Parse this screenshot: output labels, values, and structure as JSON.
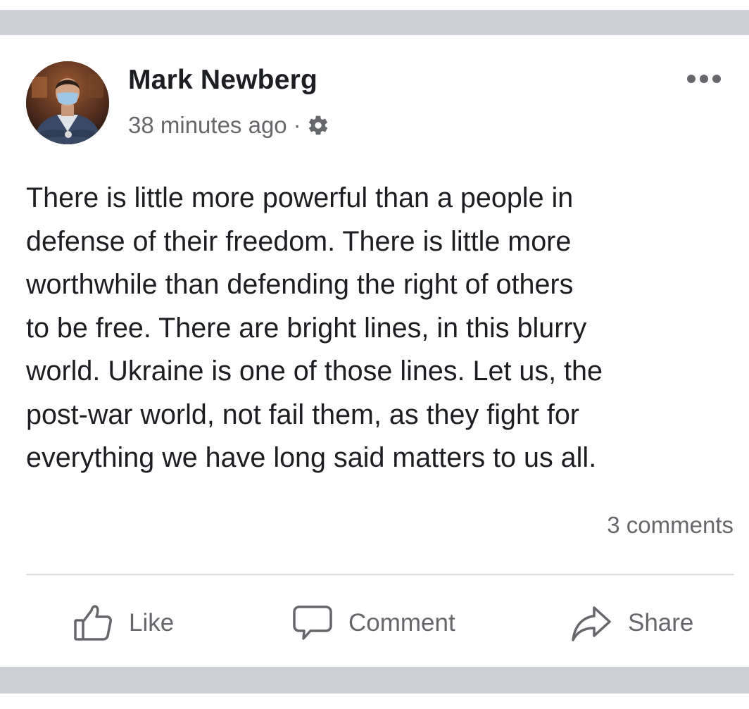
{
  "post": {
    "author": "Mark Newberg",
    "timestamp": "38 minutes ago",
    "separator": "·",
    "privacy_icon": "gear-icon",
    "more_icon": "more-options-icon",
    "text": "There is little more powerful than a people in\ndefense of their freedom. There is little more\nworthwhile than defending the right of others\nto be free. There are bright lines, in this blurry\nworld. Ukraine is one of those lines. Let us, the\npost-war world, not fail them, as they fight for\neverything we have long said matters to us all.",
    "comments_count": "3 comments"
  },
  "actions": {
    "like": {
      "label": "Like",
      "icon": "thumbs-up-icon"
    },
    "comment": {
      "label": "Comment",
      "icon": "comment-bubble-icon"
    },
    "share": {
      "label": "Share",
      "icon": "share-arrow-icon"
    }
  },
  "colors": {
    "text_primary": "#1c1e21",
    "text_secondary": "#65676b",
    "divider": "#dadde1",
    "background_band": "#cdd0d6"
  }
}
